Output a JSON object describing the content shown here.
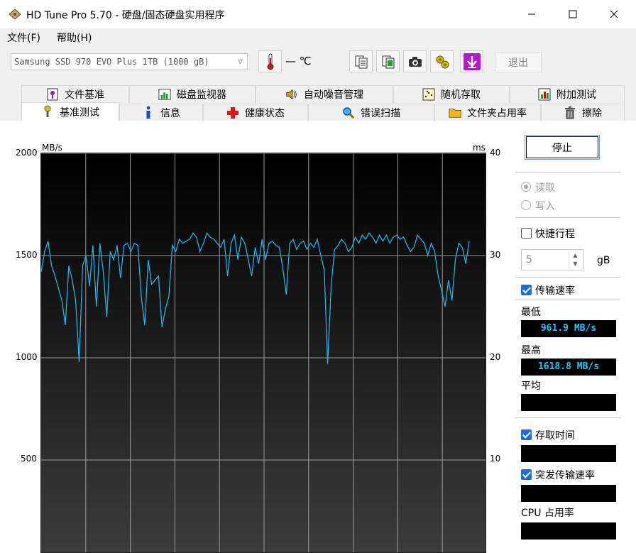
{
  "window": {
    "title": "HD Tune Pro 5.70 - 硬盘/固态硬盘实用程序",
    "icon": "disk-app-icon",
    "controls": [
      "minimize-icon",
      "maximize-icon",
      "close-icon"
    ]
  },
  "menu": {
    "file": "文件(F)",
    "help": "帮助(H)"
  },
  "toolbar": {
    "drive": "Samsung SSD 970 EVO Plus 1TB (1000 gB)",
    "temperature": "— ℃",
    "exit_label": "退出",
    "icons": [
      "thermometer-icon",
      "copy-text-icon",
      "copy-screenshot-icon",
      "camera-icon",
      "settings-icon",
      "download-icon"
    ]
  },
  "tabs_top": [
    "文件基准",
    "磁盘监视器",
    "自动噪音管理",
    "随机存取",
    "附加测试"
  ],
  "tabs_bottom": [
    "基准测试",
    "信息",
    "健康状态",
    "错误扫描",
    "文件夹占用率",
    "擦除"
  ],
  "active_tab": "基准测试",
  "graph": {
    "left_unit": "MB/s",
    "right_unit": "ms",
    "left_ticks": [
      "2000",
      "1500",
      "1000",
      "500"
    ],
    "right_ticks": [
      "40",
      "30",
      "20",
      "10"
    ]
  },
  "side": {
    "stop_label": "停止",
    "read_label": "读取",
    "write_label": "写入",
    "read_selected": true,
    "quick_label": "快捷行程",
    "quick_checked": false,
    "quick_value": "5",
    "quick_unit": "gB",
    "transfer_label": "传输速率",
    "transfer_checked": true,
    "min_label": "最低",
    "min_value": "961.9 MB/s",
    "max_label": "最高",
    "max_value": "1618.8 MB/s",
    "avg_label": "平均",
    "avg_value": "",
    "access_label": "存取时间",
    "access_checked": true,
    "access_value": "",
    "burst_label": "突发传输速率",
    "burst_checked": true,
    "burst_value": "",
    "cpu_label": "CPU 占用率",
    "cpu_value": ""
  },
  "chart_data": {
    "type": "line",
    "ylabel": "MB/s",
    "ylabel_right": "ms",
    "ylim": [
      0,
      2000
    ],
    "ylim_right": [
      0,
      40
    ],
    "yticks": [
      500,
      1000,
      1500,
      2000
    ],
    "yticks_right": [
      10,
      20,
      30,
      40
    ],
    "grid": true,
    "series": [
      {
        "color": "#18b4e8",
        "values": [
          1420,
          1520,
          1570,
          1450,
          1400,
          1340,
          1280,
          1160,
          1450,
          1380,
          1280,
          980,
          1450,
          1500,
          1350,
          1550,
          1250,
          1560,
          1420,
          1200,
          1520,
          1480,
          1550,
          1390,
          1550,
          1560,
          1520,
          1560,
          1550,
          1300,
          1160,
          1480,
          1360,
          1380,
          1400,
          1150,
          1240,
          1300,
          1550,
          1520,
          1580,
          1560,
          1570,
          1580,
          1610,
          1590,
          1520,
          1560,
          1610,
          1590,
          1580,
          1560,
          1540,
          1580,
          1400,
          1560,
          1600,
          1480,
          1590,
          1560,
          1480,
          1400,
          1540,
          1460,
          1580,
          1480,
          1560,
          1570,
          1550,
          1540,
          1440,
          1310,
          1560,
          1580,
          1530,
          1560,
          1570,
          1530,
          1560,
          1540,
          1580,
          1500,
          1430,
          970,
          1350,
          1530,
          1550,
          1580,
          1560,
          1520,
          1540,
          1590,
          1560,
          1600,
          1580,
          1610,
          1590,
          1560,
          1600,
          1570,
          1600,
          1560,
          1590,
          1600,
          1580,
          1590,
          1550,
          1520,
          1540,
          1600,
          1580,
          1560,
          1500,
          1560,
          1520,
          1400,
          1330,
          1250,
          1380,
          1280,
          1480,
          1560,
          1540,
          1460,
          1570
        ]
      }
    ]
  }
}
